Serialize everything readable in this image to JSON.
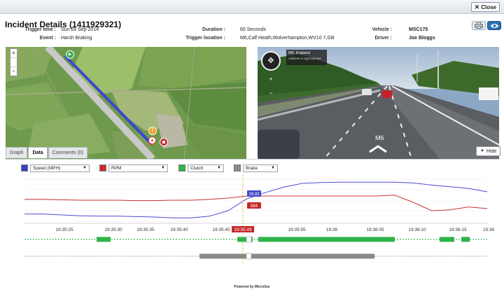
{
  "window": {
    "close_label": "Close"
  },
  "header": {
    "title": "Incident Details (1411929321)",
    "fields": [
      {
        "label": "Trigger time :",
        "value": "Sun 28 Sep 2014"
      },
      {
        "label": "Event :",
        "value": "Harsh Braking"
      },
      {
        "label": "Duration :",
        "value": "60 Seconds"
      },
      {
        "label": "Trigger location :",
        "value": "M6,Calf Heath,Wolverhampton,WV10 7,GB"
      },
      {
        "label": "Vehicle :",
        "value": "MSC175"
      },
      {
        "label": "Driver :",
        "value": "Joe Bloggs"
      }
    ],
    "icons": [
      "print-icon",
      "eye-icon"
    ]
  },
  "streetview": {
    "location_title": "M6, England",
    "location_sub": "Address is approximate",
    "road_label": "M6",
    "hide_label": "Hide"
  },
  "tabs": [
    {
      "label": "Graph",
      "active": false
    },
    {
      "label": "Data",
      "active": true
    },
    {
      "label": "Comments (0)",
      "active": false
    }
  ],
  "selectors": [
    {
      "label": "Speed (MPH)",
      "color": "#3a3ad0"
    },
    {
      "label": "RPM",
      "color": "#d02a2a"
    },
    {
      "label": "Clutch",
      "color": "#2db34a"
    },
    {
      "label": "Brake",
      "color": "#8a8a8a"
    }
  ],
  "chart_data": {
    "type": "line",
    "x_ticks": [
      "19:35:25",
      "19:35:30",
      "19:35:35",
      "19:35:40",
      "19:35:45",
      "19:35:49",
      "19:35:55",
      "19:36",
      "19:36:05",
      "19:36:10",
      "19:36:15",
      "19:36"
    ],
    "cursor_label": "19:35:49",
    "cursor_values": {
      "speed": "29.83",
      "rpm": "984"
    },
    "series": [
      {
        "name": "Speed (MPH)",
        "color": "#4a4ad6",
        "values": [
          0.17,
          0.17,
          0.15,
          0.13,
          0.12,
          0.12,
          0.11,
          0.1,
          0.08,
          0.08,
          0.12,
          0.25,
          0.53,
          0.68,
          0.81,
          0.9,
          0.92,
          0.93,
          0.93,
          0.93,
          0.93,
          0.91,
          0.86,
          0.82,
          0.78,
          0.7
        ]
      },
      {
        "name": "RPM",
        "color": "#c83232",
        "values": [
          0.52,
          0.52,
          0.51,
          0.5,
          0.5,
          0.5,
          0.49,
          0.49,
          0.5,
          0.5,
          0.52,
          0.55,
          0.6,
          0.6,
          0.6,
          0.6,
          0.6,
          0.6,
          0.6,
          0.6,
          0.62,
          0.45,
          0.25,
          0.27,
          0.34,
          0.3
        ]
      }
    ],
    "tracks": [
      {
        "name": "Clutch",
        "color": "#2db34a"
      },
      {
        "name": "Brake",
        "color": "#8a8a8a"
      }
    ]
  },
  "footer": {
    "powered_by": "Powered by Microlise"
  }
}
